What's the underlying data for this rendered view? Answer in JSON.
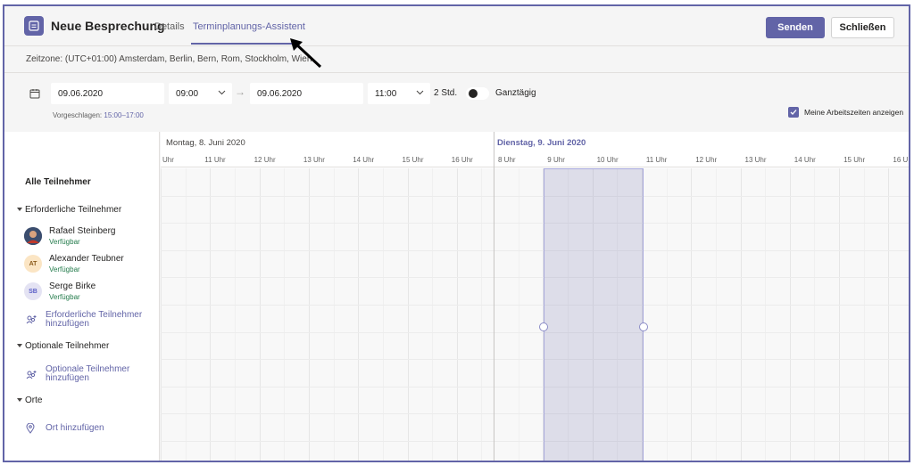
{
  "header": {
    "title": "Neue Besprechung",
    "tabs": [
      {
        "label": "Details",
        "active": false
      },
      {
        "label": "Terminplanungs-Assistent",
        "active": true
      }
    ],
    "send_label": "Senden",
    "close_label": "Schließen"
  },
  "timezone": "Zeitzone: (UTC+01:00) Amsterdam, Berlin, Bern, Rom, Stockholm, Wien",
  "datetime": {
    "start_date": "09.06.2020",
    "start_time": "09:00",
    "end_date": "09.06.2020",
    "end_time": "11:00",
    "duration": "2 Std.",
    "allday_label": "Ganztägig",
    "allday_on": false,
    "suggested_label": "Vorgeschlagen:",
    "suggested_value": "15:00–17:00"
  },
  "work_hours": {
    "label": "Meine Arbeitszeiten anzeigen",
    "checked": true
  },
  "timeline": {
    "day1": "Montag, 8. Juni 2020",
    "day2": "Dienstag, 9. Juni 2020",
    "day1_hours": [
      "Uhr",
      "11 Uhr",
      "12 Uhr",
      "13 Uhr",
      "14 Uhr",
      "15 Uhr",
      "16 Uhr"
    ],
    "day2_hours": [
      "8 Uhr",
      "9 Uhr",
      "10 Uhr",
      "11 Uhr",
      "12 Uhr",
      "13 Uhr",
      "14 Uhr",
      "15 Uhr",
      "16 U"
    ]
  },
  "attendees": {
    "all_label": "Alle Teilnehmer",
    "required_label": "Erforderliche Teilnehmer",
    "people": [
      {
        "name": "Rafael Steinberg",
        "status": "Verfügbar",
        "initials": ""
      },
      {
        "name": "Alexander Teubner",
        "status": "Verfügbar",
        "initials": "AT"
      },
      {
        "name": "Serge Birke",
        "status": "Verfügbar",
        "initials": "SB"
      }
    ],
    "add_required_1": "Erforderliche Teilnehmer",
    "add_required_2": "hinzufügen",
    "optional_label": "Optionale Teilnehmer",
    "add_optional_1": "Optionale Teilnehmer",
    "add_optional_2": "hinzufügen",
    "locations_label": "Orte",
    "add_location": "Ort hinzufügen"
  },
  "colors": {
    "accent": "#6264a7",
    "available": "#237b4b"
  }
}
